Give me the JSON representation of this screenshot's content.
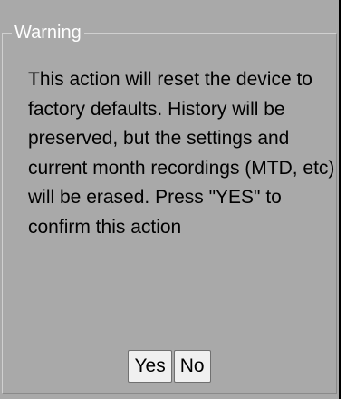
{
  "dialog": {
    "legend": "Warning",
    "message": "This action will reset the device to factory defaults. History will be preserved, but the settings and current month recordings (MTD, etc) will be erased. Press \"YES\" to confirm this action",
    "buttons": {
      "yes_label": "Yes",
      "no_label": "No"
    }
  },
  "colors": {
    "panel_background": "#a9a9a9",
    "legend_text": "#ffffff",
    "message_text": "#000000",
    "button_background": "#f0f0f0"
  }
}
